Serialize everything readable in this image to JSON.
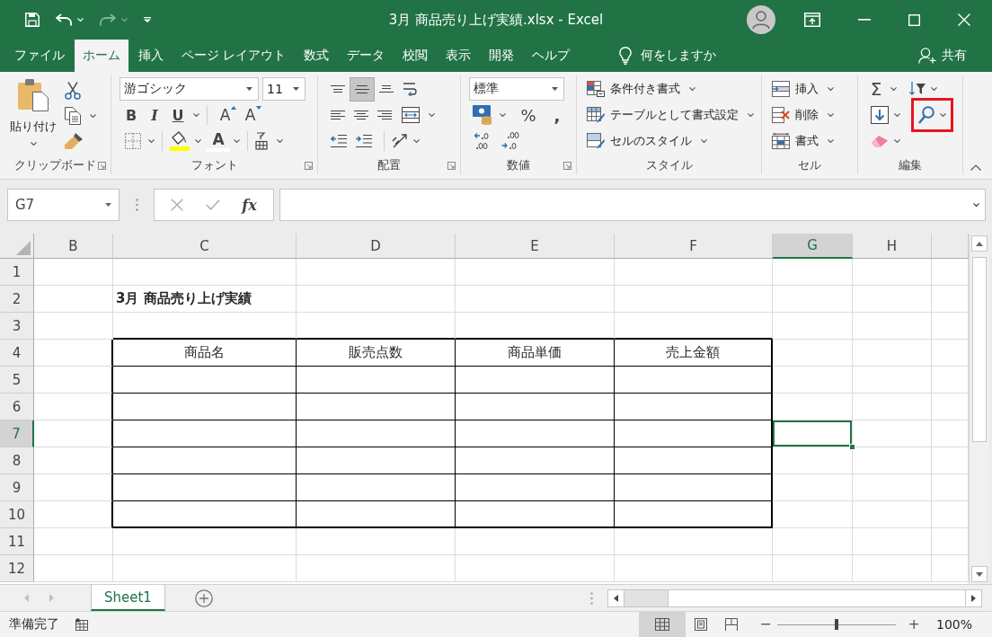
{
  "title_bar": {
    "title": "3月 商品売り上げ実績.xlsx - Excel"
  },
  "quick_access": [
    {
      "disabled": false
    },
    {
      "disabled": true
    }
  ],
  "menu_tabs": [
    {
      "label": "ファイル",
      "selected": false
    },
    {
      "label": "ホーム",
      "selected": true
    },
    {
      "label": "挿入",
      "selected": false
    },
    {
      "label": "ページ レイアウト",
      "selected": false
    },
    {
      "label": "数式",
      "selected": false
    },
    {
      "label": "データ",
      "selected": false
    },
    {
      "label": "校閲",
      "selected": false
    },
    {
      "label": "表示",
      "selected": false
    },
    {
      "label": "開発",
      "selected": false
    },
    {
      "label": "ヘルプ",
      "selected": false
    }
  ],
  "tell_me": {
    "label": "何をしますか"
  },
  "share": {
    "label": "共有"
  },
  "ribbon": {
    "clipboard": {
      "label": "クリップボード",
      "paste": "貼り付け"
    },
    "font": {
      "label": "フォント",
      "font_name": "游ゴシック",
      "font_size": "11",
      "bold": "B",
      "italic": "I",
      "underline": "U",
      "grow": "A",
      "shrink": "A",
      "font_color": "A"
    },
    "alignment": {
      "label": "配置",
      "vertical_align": [
        {
          "selected": false
        },
        {
          "selected": true
        },
        {
          "selected": false
        }
      ]
    },
    "number": {
      "label": "数値",
      "format": "標準",
      "percent": "%",
      "comma": ","
    },
    "styles": {
      "label": "スタイル",
      "buttons": [
        "条件付き書式",
        "テーブルとして書式設定",
        "セルのスタイル"
      ]
    },
    "cells": {
      "label": "セル",
      "buttons": [
        "挿入",
        "削除",
        "書式"
      ]
    },
    "editing": {
      "label": "編集",
      "sum": "Σ",
      "find_highlighted": true
    }
  },
  "formula_bar": {
    "name_box": "G7",
    "buttons": [
      {
        "disabled": true
      },
      {
        "disabled": true
      }
    ],
    "insert_function": "fx"
  },
  "sheet": {
    "columns": [
      {
        "label": "B",
        "selected": false
      },
      {
        "label": "C",
        "selected": false
      },
      {
        "label": "D",
        "selected": false
      },
      {
        "label": "E",
        "selected": false
      },
      {
        "label": "F",
        "selected": false
      },
      {
        "label": "G",
        "selected": true
      },
      {
        "label": "H",
        "selected": false
      }
    ],
    "rows": [
      {
        "label": "1",
        "selected": false,
        "kind": "blank"
      },
      {
        "label": "2",
        "selected": false,
        "kind": "title",
        "cells": [
          "3月 商品売り上げ実績"
        ]
      },
      {
        "label": "3",
        "selected": false,
        "kind": "blank"
      },
      {
        "label": "4",
        "selected": false,
        "kind": "table_header",
        "cells": [
          "商品名",
          "販売点数",
          "商品単価",
          "売上金額"
        ]
      },
      {
        "label": "5",
        "selected": false,
        "kind": "table_body"
      },
      {
        "label": "6",
        "selected": false,
        "kind": "table_body"
      },
      {
        "label": "7",
        "selected": true,
        "kind": "table_body"
      },
      {
        "label": "8",
        "selected": false,
        "kind": "table_body"
      },
      {
        "label": "9",
        "selected": false,
        "kind": "table_body"
      },
      {
        "label": "10",
        "selected": false,
        "kind": "table_body"
      },
      {
        "label": "11",
        "selected": false,
        "kind": "blank"
      },
      {
        "label": "12",
        "selected": false,
        "kind": "blank"
      }
    ]
  },
  "sheet_nav": [
    {
      "disabled": true
    },
    {
      "disabled": true
    }
  ],
  "sheet_tabs": [
    {
      "label": "Sheet1",
      "selected": true
    }
  ],
  "status_bar": {
    "status": "準備完了",
    "views": [
      {
        "selected": true
      },
      {
        "selected": false
      },
      {
        "selected": false
      }
    ],
    "zoom": {
      "minus": "−",
      "plus": "+",
      "level": 0.5,
      "reading": "100%"
    }
  }
}
